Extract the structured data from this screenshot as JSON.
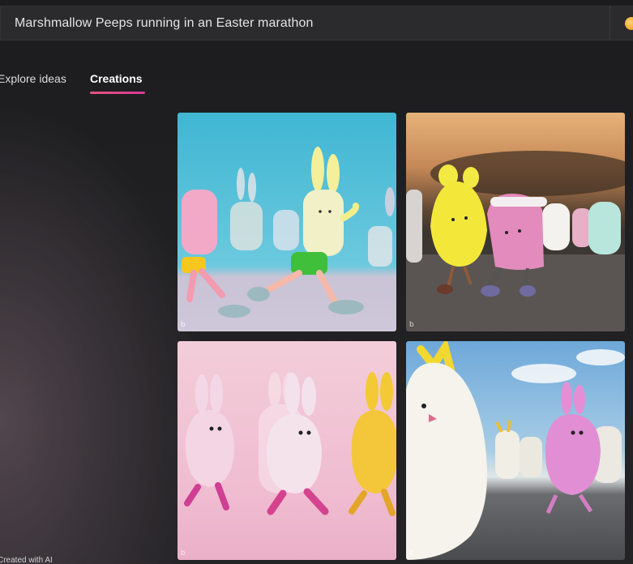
{
  "search": {
    "query": "Marshmallow Peeps running in an Easter marathon",
    "reward_icon": "rewards-coin-icon",
    "reward_color": "#f0a81e"
  },
  "tabs": [
    {
      "label": "Explore ideas",
      "active": false
    },
    {
      "label": "Creations",
      "active": true
    }
  ],
  "accent_color": "#e2557d",
  "images": [
    {
      "subject": "pink and cream bunny peeps running on blue background",
      "watermark": "b"
    },
    {
      "subject": "yellow and pink peeps running on road at sunset",
      "watermark": "b"
    },
    {
      "subject": "pink bunny peeps running on pink background",
      "watermark": "b"
    },
    {
      "subject": "white and pink peeps running under blue sky",
      "watermark": "b"
    }
  ],
  "footer": {
    "created_with_ai": "Created with AI"
  }
}
